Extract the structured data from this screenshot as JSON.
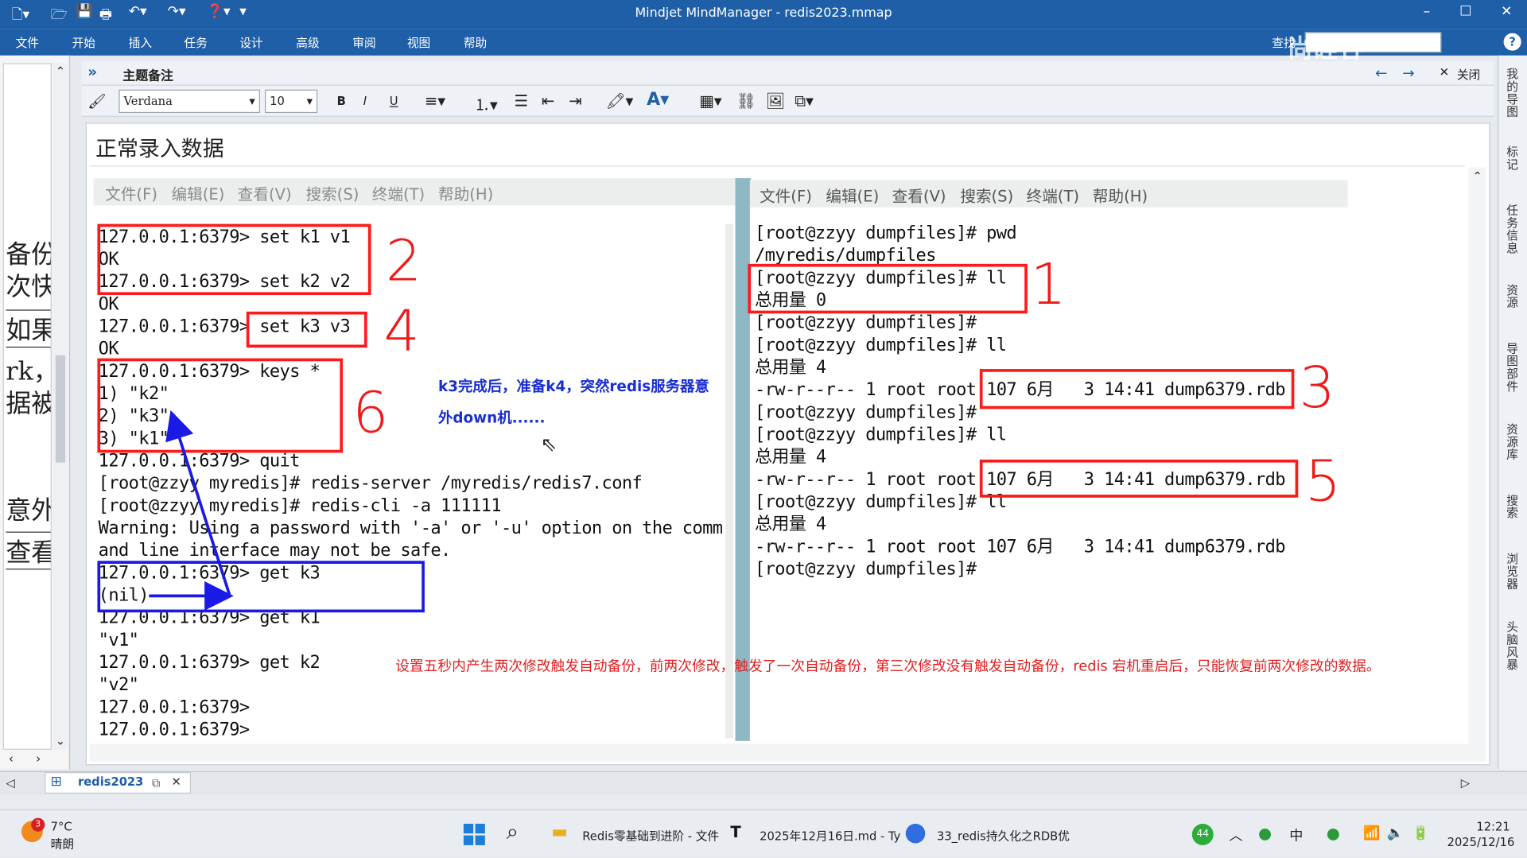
{
  "window": {
    "title": "Mindjet MindManager - redis2023.mmap",
    "minimize": "–",
    "maximize": "☐",
    "close": "✕"
  },
  "menubar": {
    "items": [
      "文件",
      "开始",
      "插入",
      "任务",
      "设计",
      "高级",
      "审阅",
      "视图",
      "帮助"
    ],
    "search_label": "查找",
    "watermark": "尚硅谷"
  },
  "left_outline": {
    "lines": [
      "备份",
      "次快",
      "如果",
      "rk，",
      "据被",
      "意外",
      "查看"
    ]
  },
  "notes_panel": {
    "title": "主题备注",
    "expand_glyph": "»",
    "close_label": "关闭",
    "font_name": "Verdana",
    "font_size": "10",
    "heading": "正常录入数据"
  },
  "terminal_left": {
    "menu": [
      "文件(F)",
      "编辑(E)",
      "查看(V)",
      "搜索(S)",
      "终端(T)",
      "帮助(H)"
    ],
    "lines": [
      "127.0.0.1:6379> set k1 v1",
      "OK",
      "127.0.0.1:6379> set k2 v2",
      "OK",
      "127.0.0.1:6379> set k3 v3",
      "OK",
      "127.0.0.1:6379> keys *",
      "1) \"k2\"",
      "2) \"k3\"",
      "3) \"k1\"",
      "127.0.0.1:6379> quit",
      "[root@zzyy myredis]# redis-server /myredis/redis7.conf",
      "[root@zzyy myredis]# redis-cli -a 111111",
      "Warning: Using a password with '-a' or '-u' option on the comm",
      "and line interface may not be safe.",
      "127.0.0.1:6379> get k3",
      "(nil)",
      "127.0.0.1:6379> get k1",
      "\"v1\"",
      "127.0.0.1:6379> get k2",
      "\"v2\"",
      "127.0.0.1:6379>",
      "127.0.0.1:6379>"
    ]
  },
  "terminal_right": {
    "menu": [
      "文件(F)",
      "编辑(E)",
      "查看(V)",
      "搜索(S)",
      "终端(T)",
      "帮助(H)"
    ],
    "lines": [
      "[root@zzyy dumpfiles]# pwd",
      "/myredis/dumpfiles",
      "[root@zzyy dumpfiles]# ll",
      "总用量 0",
      "[root@zzyy dumpfiles]#",
      "[root@zzyy dumpfiles]# ll",
      "总用量 4",
      "-rw-r--r-- 1 root root 107 6月   3 14:41 dump6379.rdb",
      "[root@zzyy dumpfiles]#",
      "[root@zzyy dumpfiles]# ll",
      "总用量 4",
      "-rw-r--r-- 1 root root 107 6月   3 14:41 dump6379.rdb",
      "[root@zzyy dumpfiles]# ll",
      "总用量 4",
      "-rw-r--r-- 1 root root 107 6月   3 14:41 dump6379.rdb",
      "[root@zzyy dumpfiles]#"
    ]
  },
  "annotations": {
    "numbers": [
      "2",
      "4",
      "6",
      "1",
      "3",
      "5"
    ],
    "blue_note": "k3完成后，准备k4，突然redis服务器意外down机......",
    "red_note": "设置五秒内产生两次修改触发自动备份，前两次修改，触发了一次自动备份，第三次修改没有触发自动备份，redis 宕机重启后，只能恢复前两次修改的数据。"
  },
  "right_sidebar": {
    "items": [
      "我的导图",
      "标记",
      "任务信息",
      "资源",
      "导图部件",
      "资源库",
      "搜索",
      "浏览器",
      "头脑风暴"
    ]
  },
  "doc_tab": {
    "label": "redis2023",
    "close": "✕"
  },
  "taskbar": {
    "weather_temp": "7°C",
    "weather_desc": "晴朗",
    "weather_badge": "3",
    "apps": [
      {
        "label": "Redis零基础到进阶 - 文件"
      },
      {
        "label": "2025年12月16日.md - Ty"
      },
      {
        "label": "33_redis持久化之RDB优"
      }
    ],
    "tray_count": "44",
    "ime": "中",
    "time": "12:21",
    "date": "2025/12/16"
  },
  "colors": {
    "titlebar": "#1f5fa8",
    "annotation_red": "#ff1a1a",
    "annotation_blue": "#1a1ae6"
  }
}
